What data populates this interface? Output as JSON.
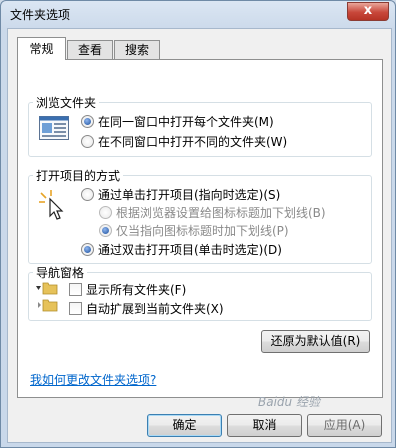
{
  "window": {
    "title": "文件夹选项",
    "close_glyph": "x"
  },
  "tabs": [
    {
      "label": "常规",
      "active": true
    },
    {
      "label": "查看",
      "active": false
    },
    {
      "label": "搜索",
      "active": false
    }
  ],
  "browse_folders": {
    "title": "浏览文件夹",
    "options": [
      {
        "label": "在同一窗口中打开每个文件夹(M)",
        "checked": true
      },
      {
        "label": "在不同窗口中打开不同的文件夹(W)",
        "checked": false
      }
    ]
  },
  "open_items": {
    "title": "打开项目的方式",
    "options": [
      {
        "label": "通过单击打开项目(指向时选定)(S)",
        "checked": false
      },
      {
        "label": "根据浏览器设置给图标标题加下划线(B)",
        "checked": false,
        "disabled": true
      },
      {
        "label": "仅当指向图标标题时加下划线(P)",
        "checked": true,
        "disabled": true
      },
      {
        "label": "通过双击打开项目(单击时选定)(D)",
        "checked": true
      }
    ]
  },
  "nav_pane": {
    "title": "导航窗格",
    "options": [
      {
        "label": "显示所有文件夹(F)",
        "checked": false
      },
      {
        "label": "自动扩展到当前文件夹(X)",
        "checked": false
      }
    ]
  },
  "buttons": {
    "restore_defaults": "还原为默认值(R)",
    "ok": "确定",
    "cancel": "取消",
    "apply": "应用(A)"
  },
  "help_link": "我如何更改文件夹选项?",
  "watermark": "Baidu 经验"
}
